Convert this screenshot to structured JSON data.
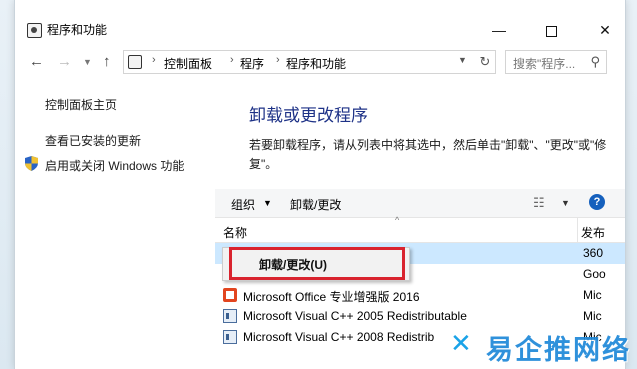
{
  "window": {
    "title": "程序和功能"
  },
  "nav": {
    "back": "←",
    "forward": "→",
    "up": "↑",
    "breadcrumbs": [
      "控制面板",
      "程序",
      "程序和功能"
    ],
    "search_placeholder": "搜索\"程序..."
  },
  "left": {
    "home": "控制面板主页",
    "updates": "查看已安装的更新",
    "features": "启用或关闭 Windows 功能"
  },
  "main": {
    "heading": "卸载或更改程序",
    "description": "若要卸载程序，请从列表中将其选中，然后单击\"卸载\"、\"更改\"或\"修复\"。"
  },
  "toolbar": {
    "organize": "组织",
    "uninstall": "卸载/更改"
  },
  "columns": {
    "name": "名称",
    "publisher": "发布"
  },
  "rows": [
    {
      "name": "",
      "publisher": "360",
      "selected": true,
      "icon": "none"
    },
    {
      "name": "",
      "publisher": "Goo",
      "selected": false,
      "icon": "none"
    },
    {
      "name": "Microsoft Office 专业增强版 2016",
      "publisher": "Mic",
      "selected": false,
      "icon": "office-icon"
    },
    {
      "name": "Microsoft Visual C++ 2005 Redistributable",
      "publisher": "Mic",
      "selected": false,
      "icon": "vc-icon"
    },
    {
      "name": "Microsoft Visual C++ 2008 Redistrib",
      "publisher": "Mic",
      "selected": false,
      "icon": "vc-icon"
    }
  ],
  "context_menu": {
    "item": "卸载/更改(U)"
  },
  "watermark": {
    "text": "易企推网络"
  }
}
